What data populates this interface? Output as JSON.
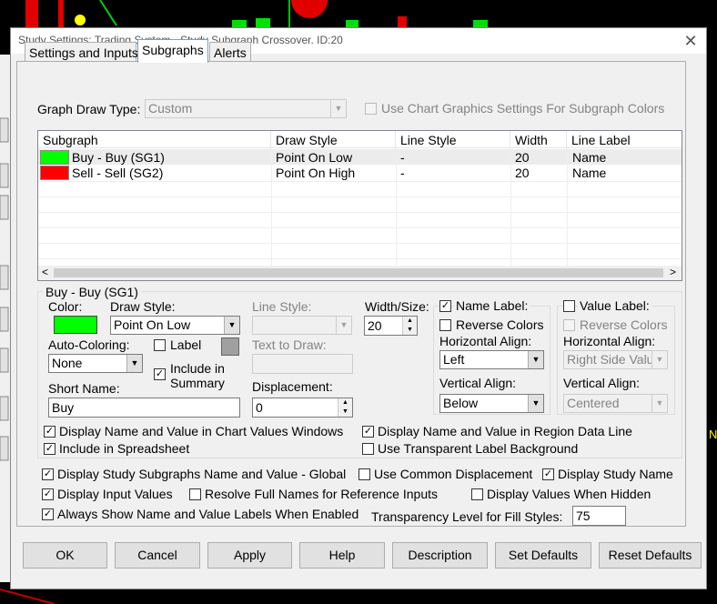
{
  "window": {
    "title": "Study Settings: Trading System - Study Subgraph Crossover. ID:20",
    "close_glyph": "✕"
  },
  "tabs": [
    {
      "label": "Settings and Inputs"
    },
    {
      "label": "Subgraphs"
    },
    {
      "label": "Alerts"
    }
  ],
  "graph_draw_type": {
    "label": "Graph Draw Type:",
    "value": "Custom",
    "use_chart_graphics_label": "Use Chart Graphics Settings For Subgraph Colors"
  },
  "subgraph_table": {
    "columns": [
      "Subgraph",
      "Draw Style",
      "Line Style",
      "Width",
      "Line Label"
    ],
    "rows": [
      {
        "color": "#00ff00",
        "name": "Buy - Buy (SG1)",
        "draw_style": "Point On Low",
        "line_style": "-",
        "width": "20",
        "line_label": "Name"
      },
      {
        "color": "#ff0000",
        "name": "Sell - Sell (SG2)",
        "draw_style": "Point On High",
        "line_style": "-",
        "width": "20",
        "line_label": "Name"
      }
    ]
  },
  "detail": {
    "group_title": "Buy - Buy (SG1)",
    "color_label": "Color:",
    "color_value": "#00ff00",
    "draw_style_label": "Draw Style:",
    "draw_style_value": "Point On Low",
    "line_style_label": "Line Style:",
    "width_size_label": "Width/Size:",
    "width_size_value": "20",
    "auto_coloring_label": "Auto-Coloring:",
    "auto_coloring_value": "None",
    "label_checkbox": "Label",
    "include_in_summary_label": "Include in Summary",
    "text_to_draw_label": "Text to Draw:",
    "short_name_label": "Short Name:",
    "short_name_value": "Buy",
    "displacement_label": "Displacement:",
    "displacement_value": "0",
    "name_label_group": {
      "title": "Name Label:",
      "reverse_colors": "Reverse Colors",
      "horizontal_align_label": "Horizontal Align:",
      "horizontal_align_value": "Left",
      "vertical_align_label": "Vertical Align:",
      "vertical_align_value": "Below"
    },
    "value_label_group": {
      "title": "Value Label:",
      "reverse_colors": "Reverse Colors",
      "horizontal_align_label": "Horizontal Align:",
      "horizontal_align_value": "Right Side Valu",
      "vertical_align_label": "Vertical Align:",
      "vertical_align_value": "Centered"
    },
    "display_name_value_chart": "Display Name and Value in Chart Values Windows",
    "display_name_value_region": "Display Name and Value in Region Data Line",
    "include_in_spreadsheet": "Include in Spreadsheet",
    "use_transparent_label_bg": "Use Transparent Label Background"
  },
  "global_options": {
    "display_subgraphs_global": "Display Study Subgraphs Name and Value - Global",
    "use_common_displacement": "Use Common Displacement",
    "display_study_name": "Display Study Name",
    "display_input_values": "Display Input Values",
    "resolve_full_names": "Resolve Full Names for Reference Inputs",
    "display_values_when_hidden": "Display Values When Hidden",
    "always_show_labels": "Always Show Name and Value Labels When Enabled",
    "transparency_label": "Transparency Level for Fill Styles:",
    "transparency_value": "75"
  },
  "buttons": {
    "ok": "OK",
    "cancel": "Cancel",
    "apply": "Apply",
    "help": "Help",
    "description": "Description",
    "set_defaults": "Set Defaults",
    "reset_defaults": "Reset Defaults"
  },
  "checkmark": "✓",
  "arrow_down": "▼",
  "arrow_up": "▲",
  "arrow_left": "<",
  "arrow_right": ">"
}
